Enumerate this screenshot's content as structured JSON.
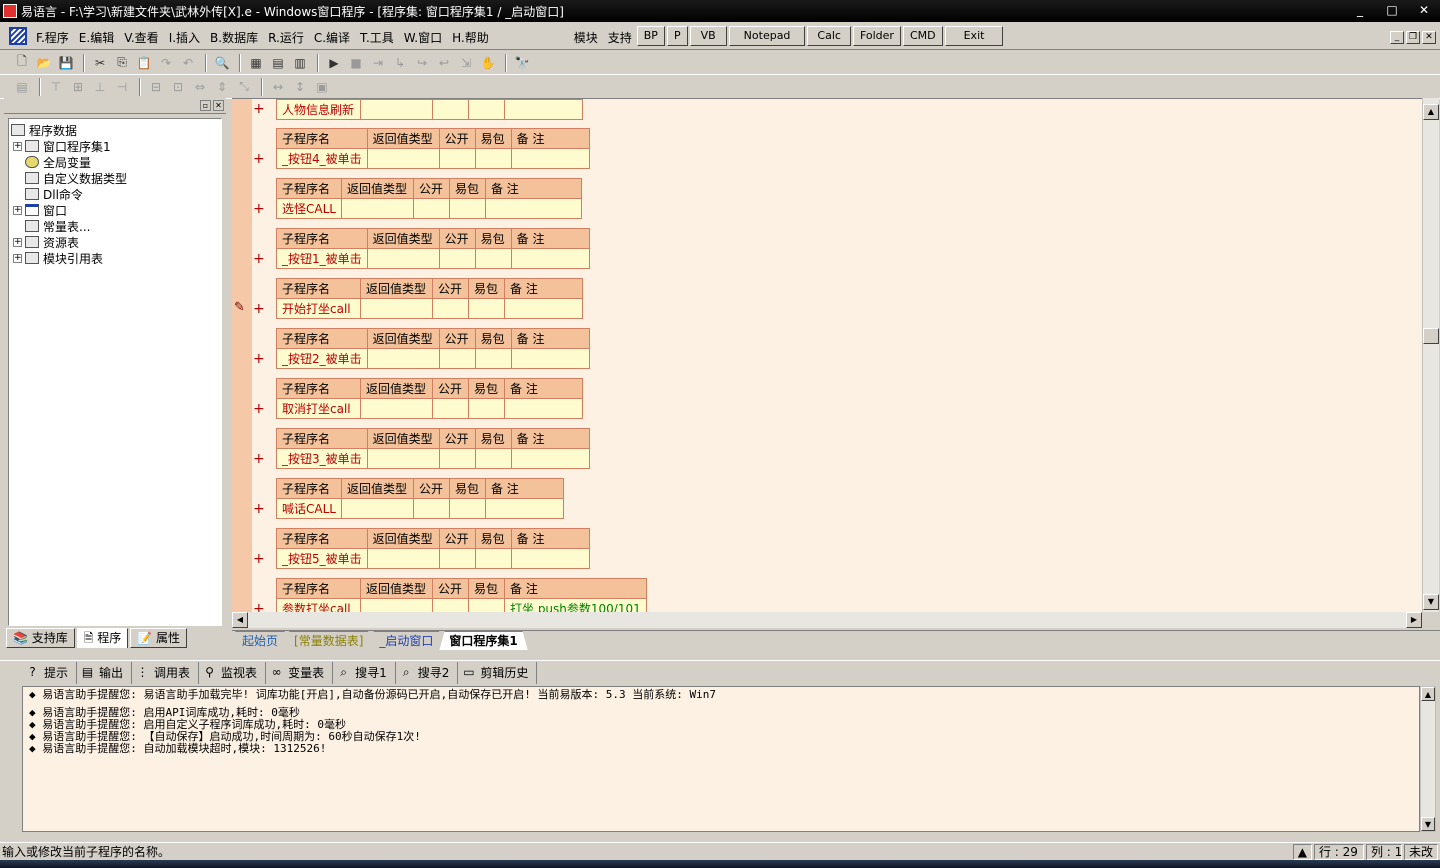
{
  "window": {
    "title": "易语言 - F:\\学习\\新建文件夹\\武林外传[X].e - Windows窗口程序 - [程序集: 窗口程序集1 / _启动窗口]",
    "controls": [
      "_",
      "□",
      "✕"
    ]
  },
  "menu": {
    "items": [
      "F.程序",
      "E.编辑",
      "V.查看",
      "I.插入",
      "B.数据库",
      "R.运行",
      "C.编译",
      "T.工具",
      "W.窗口",
      "H.帮助"
    ],
    "extra": [
      "模块",
      "支持"
    ],
    "quick_buttons": [
      "BP",
      "P",
      "VB",
      "Notepad",
      "Calc",
      "Folder",
      "CMD",
      "Exit"
    ],
    "mdi_controls": [
      "_",
      "❐",
      "✕"
    ]
  },
  "tree": {
    "root": "程序数据",
    "nodes": [
      "窗口程序集1",
      "全局变量",
      "自定义数据类型",
      "Dll命令",
      "窗口",
      "常量表...",
      "资源表",
      "模块引用表"
    ]
  },
  "left_tabs": [
    "支持库",
    "程序",
    "属性"
  ],
  "sub_header": {
    "name": "子程序名",
    "ret": "返回值类型",
    "public": "公开",
    "easy": "易包",
    "remark": "备 注"
  },
  "subroutines": [
    {
      "name": "人物信息刷新",
      "remark": ""
    },
    {
      "name": "_按钮4_被单击",
      "remark": ""
    },
    {
      "name": "选怪CALL",
      "remark": ""
    },
    {
      "name": "_按钮1_被单击",
      "remark": ""
    },
    {
      "name": "开始打坐call",
      "remark": ""
    },
    {
      "name": "_按钮2_被单击",
      "remark": ""
    },
    {
      "name": "取消打坐call",
      "remark": ""
    },
    {
      "name": "_按钮3_被单击",
      "remark": ""
    },
    {
      "name": "喊话CALL",
      "remark": ""
    },
    {
      "name": "_按钮5_被单击",
      "remark": ""
    },
    {
      "name": "参数打坐call",
      "remark": "打坐 push参数100/101"
    }
  ],
  "doc_tabs": [
    "起始页",
    "[常量数据表]",
    "_启动窗口",
    "窗口程序集1"
  ],
  "output_tabs": [
    "提示",
    "输出",
    "调用表",
    "监视表",
    "变量表",
    "搜寻1",
    "搜寻2",
    "剪辑历史"
  ],
  "output_lines": [
    "◆ 易语言助手提醒您:  易语言助手加载完毕! 词库功能[开启],自动备份源码已开启,自动保存已开启!  当前易版本: 5.3  当前系统: Win7",
    "◆ 易语言助手提醒您: 启用API词库成功,耗时: 0毫秒",
    "◆ 易语言助手提醒您: 启用自定义子程序词库成功,耗时: 0毫秒",
    "◆ 易语言助手提醒您: 【自动保存】启动成功,时间周期为: 60秒自动保存1次!",
    "◆ 易语言助手提醒您: 自动加载模块超时,模块: 1312526!"
  ],
  "status": {
    "message": "输入或修改当前子程序的名称。",
    "row_label": "行 : 29",
    "col_label": "列 : 1",
    "mode": "未改"
  }
}
